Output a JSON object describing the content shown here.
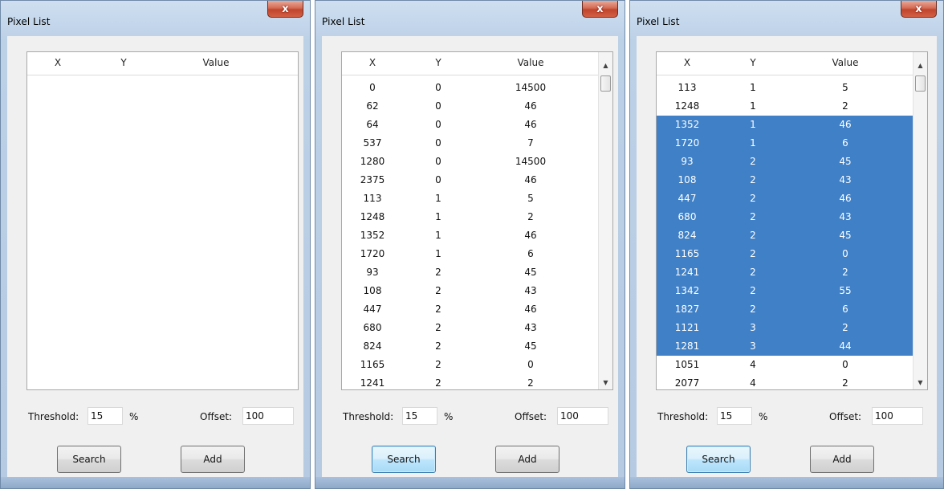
{
  "windows": [
    {
      "title": "Pixel List",
      "close_label": "x",
      "columns": {
        "x": "X",
        "y": "Y",
        "value": "Value"
      },
      "rows": [],
      "has_scrollbar": false,
      "threshold_label": "Threshold:",
      "threshold_value": "15",
      "percent_label": "%",
      "offset_label": "Offset:",
      "offset_value": "100",
      "search_label": "Search",
      "add_label": "Add",
      "search_focused": false
    },
    {
      "title": "Pixel List",
      "close_label": "x",
      "columns": {
        "x": "X",
        "y": "Y",
        "value": "Value"
      },
      "rows": [
        {
          "x": "0",
          "y": "0",
          "value": "14500",
          "selected": false
        },
        {
          "x": "62",
          "y": "0",
          "value": "46",
          "selected": false
        },
        {
          "x": "64",
          "y": "0",
          "value": "46",
          "selected": false
        },
        {
          "x": "537",
          "y": "0",
          "value": "7",
          "selected": false
        },
        {
          "x": "1280",
          "y": "0",
          "value": "14500",
          "selected": false
        },
        {
          "x": "2375",
          "y": "0",
          "value": "46",
          "selected": false
        },
        {
          "x": "113",
          "y": "1",
          "value": "5",
          "selected": false
        },
        {
          "x": "1248",
          "y": "1",
          "value": "2",
          "selected": false
        },
        {
          "x": "1352",
          "y": "1",
          "value": "46",
          "selected": false
        },
        {
          "x": "1720",
          "y": "1",
          "value": "6",
          "selected": false
        },
        {
          "x": "93",
          "y": "2",
          "value": "45",
          "selected": false
        },
        {
          "x": "108",
          "y": "2",
          "value": "43",
          "selected": false
        },
        {
          "x": "447",
          "y": "2",
          "value": "46",
          "selected": false
        },
        {
          "x": "680",
          "y": "2",
          "value": "43",
          "selected": false
        },
        {
          "x": "824",
          "y": "2",
          "value": "45",
          "selected": false
        },
        {
          "x": "1165",
          "y": "2",
          "value": "0",
          "selected": false
        },
        {
          "x": "1241",
          "y": "2",
          "value": "2",
          "selected": false
        }
      ],
      "has_scrollbar": true,
      "threshold_label": "Threshold:",
      "threshold_value": "15",
      "percent_label": "%",
      "offset_label": "Offset:",
      "offset_value": "100",
      "search_label": "Search",
      "add_label": "Add",
      "search_focused": true
    },
    {
      "title": "Pixel List",
      "close_label": "x",
      "columns": {
        "x": "X",
        "y": "Y",
        "value": "Value"
      },
      "rows": [
        {
          "x": "113",
          "y": "1",
          "value": "5",
          "selected": false
        },
        {
          "x": "1248",
          "y": "1",
          "value": "2",
          "selected": false
        },
        {
          "x": "1352",
          "y": "1",
          "value": "46",
          "selected": true
        },
        {
          "x": "1720",
          "y": "1",
          "value": "6",
          "selected": true
        },
        {
          "x": "93",
          "y": "2",
          "value": "45",
          "selected": true
        },
        {
          "x": "108",
          "y": "2",
          "value": "43",
          "selected": true
        },
        {
          "x": "447",
          "y": "2",
          "value": "46",
          "selected": true
        },
        {
          "x": "680",
          "y": "2",
          "value": "43",
          "selected": true
        },
        {
          "x": "824",
          "y": "2",
          "value": "45",
          "selected": true
        },
        {
          "x": "1165",
          "y": "2",
          "value": "0",
          "selected": true
        },
        {
          "x": "1241",
          "y": "2",
          "value": "2",
          "selected": true
        },
        {
          "x": "1342",
          "y": "2",
          "value": "55",
          "selected": true
        },
        {
          "x": "1827",
          "y": "2",
          "value": "6",
          "selected": true
        },
        {
          "x": "1121",
          "y": "3",
          "value": "2",
          "selected": true
        },
        {
          "x": "1281",
          "y": "3",
          "value": "44",
          "selected": true
        },
        {
          "x": "1051",
          "y": "4",
          "value": "0",
          "selected": false
        },
        {
          "x": "2077",
          "y": "4",
          "value": "2",
          "selected": false
        }
      ],
      "has_scrollbar": true,
      "threshold_label": "Threshold:",
      "threshold_value": "15",
      "percent_label": "%",
      "offset_label": "Offset:",
      "offset_value": "100",
      "search_label": "Search",
      "add_label": "Add",
      "search_focused": true
    }
  ]
}
